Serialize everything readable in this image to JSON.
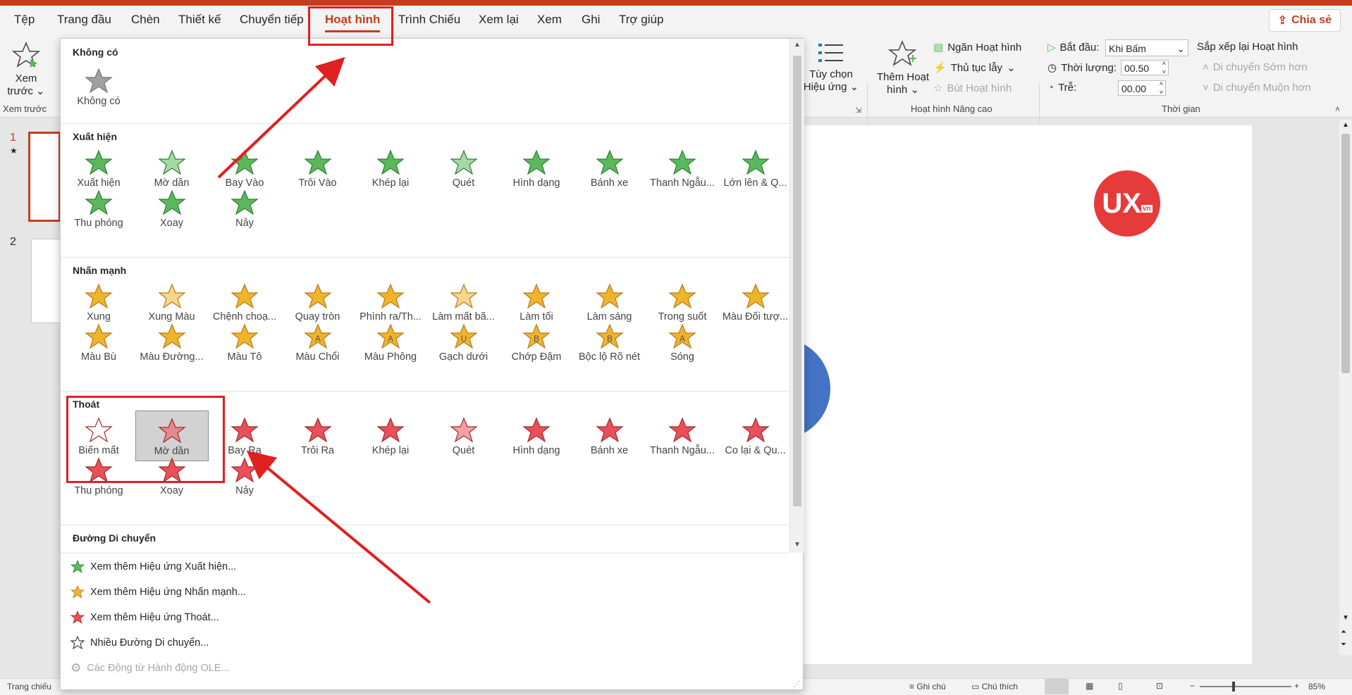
{
  "tabs": [
    {
      "id": "tep",
      "label": "Tệp"
    },
    {
      "id": "trang-dau",
      "label": "Trang đầu"
    },
    {
      "id": "chen",
      "label": "Chèn"
    },
    {
      "id": "thiet-ke",
      "label": "Thiết kế"
    },
    {
      "id": "chuyen-tiep",
      "label": "Chuyển tiếp"
    },
    {
      "id": "hoat-hinh",
      "label": "Hoạt hình",
      "active": true
    },
    {
      "id": "trinh-chieu",
      "label": "Trình Chiếu"
    },
    {
      "id": "xem-lai",
      "label": "Xem lại"
    },
    {
      "id": "xem",
      "label": "Xem"
    },
    {
      "id": "ghi",
      "label": "Ghi"
    },
    {
      "id": "tro-giup",
      "label": "Trợ giúp"
    }
  ],
  "share_label": "Chia sẻ",
  "ribbon": {
    "preview_label_1": "Xem",
    "preview_label_2": "trước",
    "preview_group": "Xem trước",
    "effect_options_1": "Tùy chọn",
    "effect_options_2": "Hiệu ứng",
    "add_anim_1": "Thêm Hoạt",
    "add_anim_2": "hình",
    "anim_pane": "Ngăn Hoạt hình",
    "trigger": "Thủ tục lẫy",
    "anim_painter": "Bút Hoạt hình",
    "advanced_group": "Hoạt hình Nâng cao",
    "start_label": "Bắt đầu:",
    "start_value": "Khi Bấm",
    "duration_label": "Thời lượng:",
    "duration_value": "00.50",
    "delay_label": "Trễ:",
    "delay_value": "00.00",
    "timing_group": "Thời gian",
    "reorder_title": "Sắp xếp lại Hoạt hình",
    "move_earlier": "Di chuyển Sớm hơn",
    "move_later": "Di chuyển Muộn hơn"
  },
  "slides": {
    "first": "1",
    "second": "2"
  },
  "logo_text": "UX",
  "logo_sub": "vn",
  "gallery": {
    "none_heading": "Không có",
    "none_item": "Không có",
    "entrance_heading": "Xuất hiện",
    "entrance": [
      "Xuất hiện",
      "Mờ dần",
      "Bay Vào",
      "Trôi Vào",
      "Khép lại",
      "Quét",
      "Hình dạng",
      "Bánh xe",
      "Thanh Ngẫu...",
      "Lớn lên & Q...",
      "Thu phóng",
      "Xoay",
      "Nảy"
    ],
    "emphasis_heading": "Nhấn mạnh",
    "emphasis": [
      "Xung",
      "Xung Màu",
      "Chệnh choạ...",
      "Quay tròn",
      "Phình ra/Th...",
      "Làm mất bã...",
      "Làm tối",
      "Làm sáng",
      "Trong suốt",
      "Màu Đối tượ...",
      "Màu Bù",
      "Màu Đường...",
      "Màu Tô",
      "Màu Chổi",
      "Màu Phông",
      "Gạch dưới",
      "Chớp Đậm",
      "Bộc lộ Rõ nét",
      "Sóng"
    ],
    "exit_heading": "Thoát",
    "exit": [
      "Biến mất",
      "Mờ dần",
      "Bay Ra",
      "Trôi Ra",
      "Khép lại",
      "Quét",
      "Hình dạng",
      "Bánh xe",
      "Thanh Ngẫu...",
      "Co lại & Qu...",
      "Thu phóng",
      "Xoay",
      "Nảy"
    ],
    "motion_heading": "Đường Di chuyển",
    "more": [
      "Xem thêm Hiệu ứng Xuất hiện...",
      "Xem thêm Hiệu ứng Nhấn mạnh...",
      "Xem thêm Hiệu ứng Thoát...",
      "Nhiều Đường Di chuyển...",
      "Các Động từ Hành động OLE..."
    ]
  },
  "status": {
    "left": "Trang chiếu",
    "notes": "Ghi chú",
    "comments": "Chú thích",
    "zoom": "85%"
  },
  "colors": {
    "accent": "#c43e1c",
    "highlight": "#e02020",
    "entrance": "#5cb85c",
    "emphasis": "#f0b429",
    "exit": "#e8505b"
  }
}
